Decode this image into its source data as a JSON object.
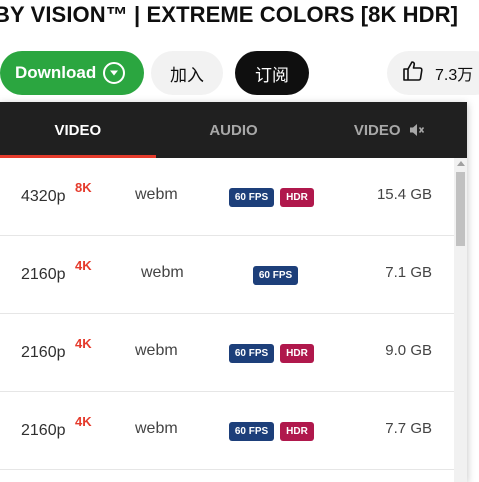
{
  "video_title": "BY VISION™ | EXTREME COLORS [8K HDR]",
  "actions": {
    "download_label": "Download",
    "join_label": "加入",
    "subscribe_label": "订阅",
    "like_count": "7.3万"
  },
  "tabs": [
    {
      "label": "VIDEO",
      "active": true
    },
    {
      "label": "AUDIO",
      "active": false
    },
    {
      "label": "VIDEO",
      "active": false,
      "icon": "mute-icon"
    }
  ],
  "formats": [
    {
      "resolution": "4320p",
      "quality_badge": "8K",
      "container": "webm",
      "fps": "60 FPS",
      "hdr": "HDR",
      "size": "15.4 GB"
    },
    {
      "resolution": "2160p",
      "quality_badge": "4K",
      "container": "webm",
      "fps": "60 FPS",
      "hdr": "",
      "size": "7.1 GB"
    },
    {
      "resolution": "2160p",
      "quality_badge": "4K",
      "container": "webm",
      "fps": "60 FPS",
      "hdr": "HDR",
      "size": "9.0 GB"
    },
    {
      "resolution": "2160p",
      "quality_badge": "4K",
      "container": "webm",
      "fps": "60 FPS",
      "hdr": "HDR",
      "size": "7.7 GB"
    }
  ],
  "colors": {
    "download_green": "#2ba640",
    "tab_bar": "#202020",
    "active_tab_underline": "#e53b2c",
    "quality_badge": "#e53b2c",
    "fps_chip": "#1d3f7a",
    "hdr_chip": "#b0184c"
  }
}
